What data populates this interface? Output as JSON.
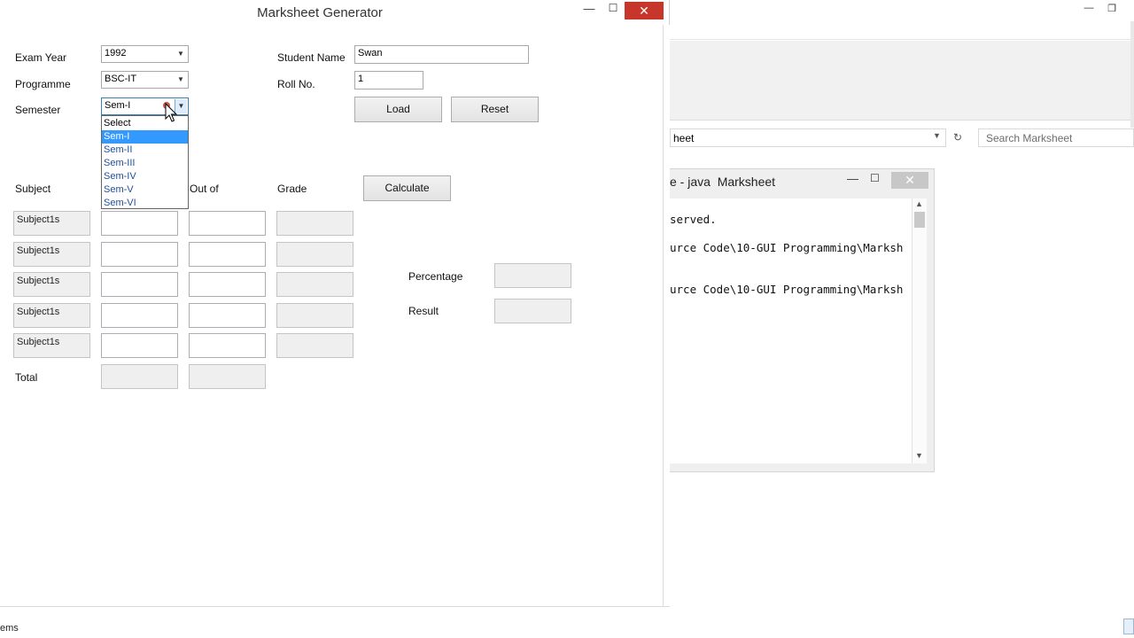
{
  "app": {
    "title": "Marksheet Generator",
    "close_symbol": "✕",
    "minimize_symbol": "—",
    "maximize_symbol": "☐"
  },
  "labels": {
    "exam_year": "Exam Year",
    "programme": "Programme",
    "semester": "Semester",
    "student_name": "Student Name",
    "roll_no": "Roll No.",
    "subject": "Subject",
    "out_of": "Out of",
    "grade": "Grade",
    "total": "Total",
    "percentage": "Percentage",
    "result": "Result"
  },
  "form": {
    "exam_year": "1992",
    "programme": "BSC-IT",
    "semester": "Sem-I",
    "student_name": "Swan",
    "roll_no": "1"
  },
  "semester_options": [
    "Select",
    "Sem-I",
    "Sem-II",
    "Sem-III",
    "Sem-IV",
    "Sem-V",
    "Sem-VI"
  ],
  "semester_selected_index": 1,
  "buttons": {
    "load": "Load",
    "reset": "Reset",
    "calculate": "Calculate"
  },
  "subjects": [
    "Subject1s",
    "Subject1s",
    "Subject1s",
    "Subject1s",
    "Subject1s"
  ],
  "background": {
    "address_text": "heet",
    "search_placeholder": "Search Marksheet",
    "status_text": "ems",
    "console": {
      "title": "e - java  Marksheet",
      "lines": [
        "served.",
        "urce Code\\10-GUI Programming\\Marksh",
        "urce Code\\10-GUI Programming\\Marksh"
      ]
    }
  },
  "colors": {
    "close_red": "#c7362b",
    "selection_blue": "#3399ff",
    "dropdown_text": "#1f4e99"
  },
  "icons": [
    "minimize-icon",
    "maximize-icon",
    "close-icon",
    "chevron-down-icon",
    "refresh-icon",
    "mouse-cursor-icon"
  ]
}
